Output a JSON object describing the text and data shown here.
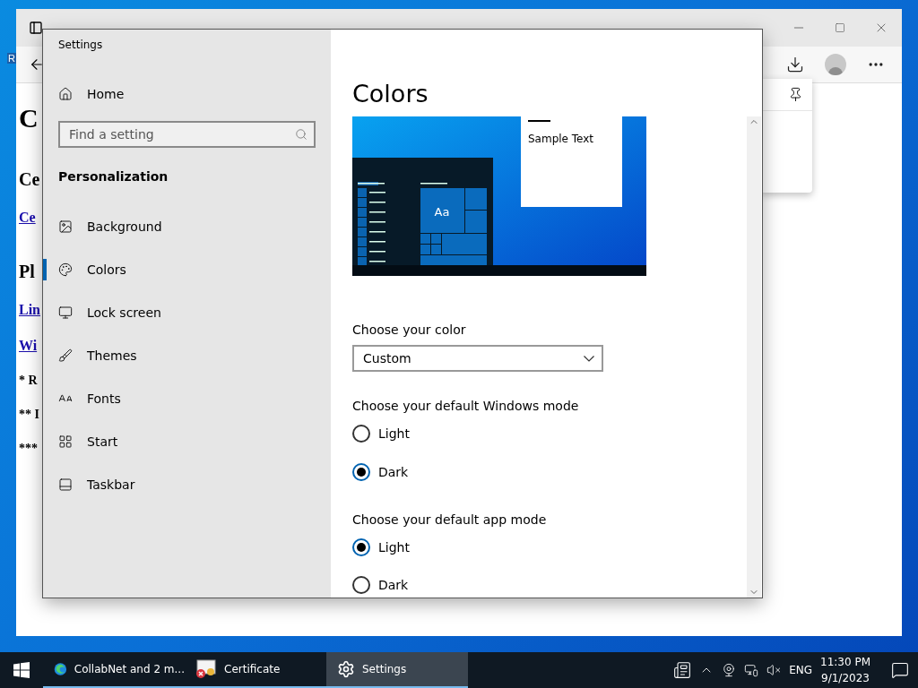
{
  "desktop": {
    "icon_label": "R"
  },
  "browser": {
    "page_lines": [
      {
        "kind": "h1",
        "text": "C"
      },
      {
        "kind": "h2",
        "text": "Ce"
      },
      {
        "kind": "link",
        "text": "Ce"
      },
      {
        "kind": "h2",
        "text": "Pl"
      },
      {
        "kind": "link",
        "text": "Lin"
      },
      {
        "kind": "link",
        "text": "Wi"
      },
      {
        "kind": "text",
        "text": "* R"
      },
      {
        "kind": "text",
        "text": "** I"
      },
      {
        "kind": "text",
        "text": "***"
      }
    ]
  },
  "settings": {
    "title": "Settings",
    "home": "Home",
    "search": {
      "placeholder": "Find a setting"
    },
    "section": "Personalization",
    "nav": [
      {
        "label": "Background",
        "selected": false
      },
      {
        "label": "Colors",
        "selected": true
      },
      {
        "label": "Lock screen",
        "selected": false
      },
      {
        "label": "Themes",
        "selected": false
      },
      {
        "label": "Fonts",
        "selected": false
      },
      {
        "label": "Start",
        "selected": false
      },
      {
        "label": "Taskbar",
        "selected": false
      }
    ],
    "page_title": "Colors",
    "preview": {
      "tile_text": "Aa",
      "sample_text": "Sample Text"
    },
    "color": {
      "label": "Choose your color",
      "value": "Custom"
    },
    "modes": [
      {
        "label": "Choose your default Windows mode",
        "options": [
          {
            "label": "Light",
            "selected": false
          },
          {
            "label": "Dark",
            "selected": true
          }
        ]
      },
      {
        "label": "Choose your default app mode",
        "options": [
          {
            "label": "Light",
            "selected": true
          },
          {
            "label": "Dark",
            "selected": false
          }
        ]
      }
    ]
  },
  "taskbar": {
    "apps": [
      {
        "label": "CollabNet and 2 m...",
        "selected": false
      },
      {
        "label": "Certificate",
        "selected": false
      },
      {
        "label": "Settings",
        "selected": true
      }
    ],
    "language": "ENG",
    "time": "11:30 PM",
    "date": "9/1/2023"
  }
}
